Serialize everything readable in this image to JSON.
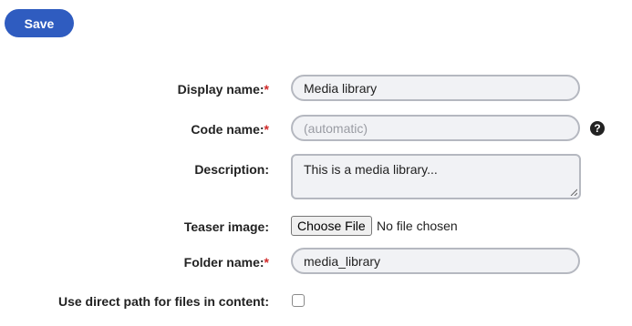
{
  "toolbar": {
    "save_label": "Save"
  },
  "required_marker": "*",
  "form": {
    "display_name": {
      "label": "Display name:",
      "value": "Media library"
    },
    "code_name": {
      "label": "Code name:",
      "placeholder": "(automatic)",
      "help_glyph": "?"
    },
    "description": {
      "label": "Description:",
      "value": "This is a media library..."
    },
    "teaser_image": {
      "label": "Teaser image:",
      "button_label": "Choose File",
      "status": "No file chosen"
    },
    "folder_name": {
      "label": "Folder name:",
      "value": "media_library"
    },
    "direct_path": {
      "label": "Use direct path for files in content:",
      "checked": false
    }
  },
  "colors": {
    "accent": "#2f5cc0",
    "required": "#d12a2a",
    "field_bg": "#f1f2f5",
    "field_border": "#b5b8c0"
  }
}
